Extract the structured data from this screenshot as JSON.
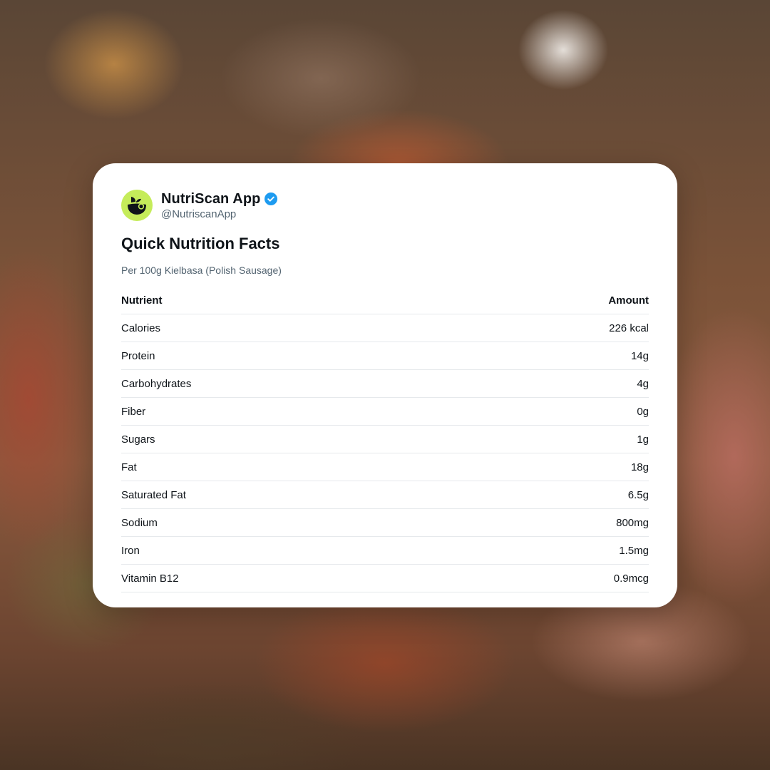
{
  "account": {
    "name": "NutriScan App",
    "handle": "@NutriscanApp",
    "avatar_icon": "nutriscan-logo-icon",
    "verified_icon": "verified-badge-icon",
    "avatar_color": "#c5ec5a",
    "verified_color": "#1d9bf0"
  },
  "post": {
    "title": "Quick Nutrition Facts",
    "subtitle": "Per 100g Kielbasa (Polish Sausage)"
  },
  "table": {
    "headers": {
      "nutrient": "Nutrient",
      "amount": "Amount"
    },
    "rows": [
      {
        "nutrient": "Calories",
        "amount": "226 kcal"
      },
      {
        "nutrient": "Protein",
        "amount": "14g"
      },
      {
        "nutrient": "Carbohydrates",
        "amount": "4g"
      },
      {
        "nutrient": "Fiber",
        "amount": "0g"
      },
      {
        "nutrient": "Sugars",
        "amount": "1g"
      },
      {
        "nutrient": "Fat",
        "amount": "18g"
      },
      {
        "nutrient": "Saturated Fat",
        "amount": "6.5g"
      },
      {
        "nutrient": "Sodium",
        "amount": "800mg"
      },
      {
        "nutrient": "Iron",
        "amount": "1.5mg"
      },
      {
        "nutrient": "Vitamin B12",
        "amount": "0.9mcg"
      }
    ]
  }
}
